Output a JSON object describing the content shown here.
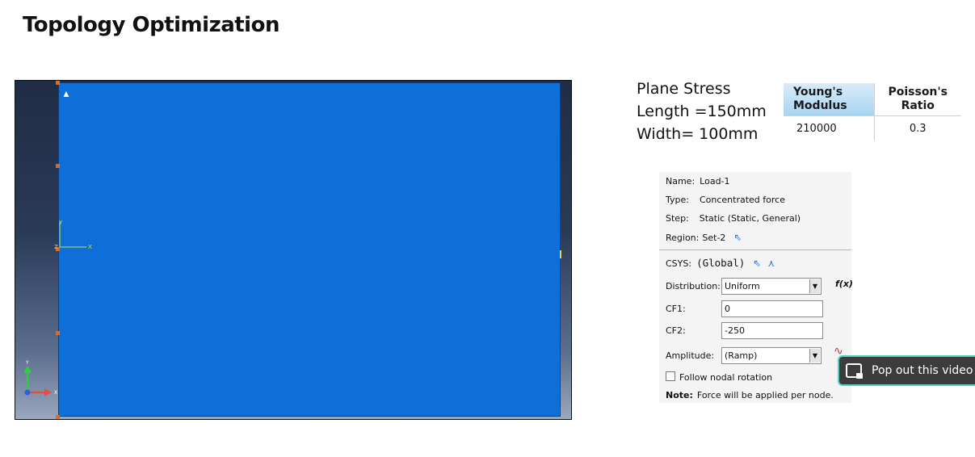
{
  "slide": {
    "title": "Topology Optimization"
  },
  "properties": {
    "line1": "Plane Stress",
    "line2": "Length =150mm",
    "line3": "Width= 100mm"
  },
  "material_table": {
    "headers": [
      "Young's Modulus",
      "Poisson's Ratio"
    ],
    "rows": [
      [
        "210000",
        "0.3"
      ]
    ]
  },
  "viewport": {
    "local_axis_labels": {
      "y": "Y",
      "x": "X",
      "z": "Z"
    },
    "global_axis_labels": {
      "y": "Y",
      "x": "X"
    },
    "colors": {
      "plate": "#0f6fd9",
      "background_top": "#1f2c44",
      "background_bottom": "#9aa7bd",
      "node": "#e06a1e"
    }
  },
  "load_dialog": {
    "name_label": "Name:",
    "name_value": "Load-1",
    "type_label": "Type:",
    "type_value": "Concentrated force",
    "step_label": "Step:",
    "step_value": "Static (Static, General)",
    "region_label": "Region:",
    "region_value": "Set-2",
    "csys_label": "CSYS:",
    "csys_value": "(Global)",
    "distribution_label": "Distribution:",
    "distribution_value": "Uniform",
    "fx_label": "f(x)",
    "cf1_label": "CF1:",
    "cf1_value": "0",
    "cf2_label": "CF2:",
    "cf2_value": "-250",
    "amplitude_label": "Amplitude:",
    "amplitude_value": "(Ramp)",
    "follow_label": "Follow nodal rotation",
    "note_label": "Note:",
    "note_text": "Force will be applied per node."
  },
  "popout": {
    "label": "Pop out this video",
    "accent": "#4fd1c5"
  }
}
